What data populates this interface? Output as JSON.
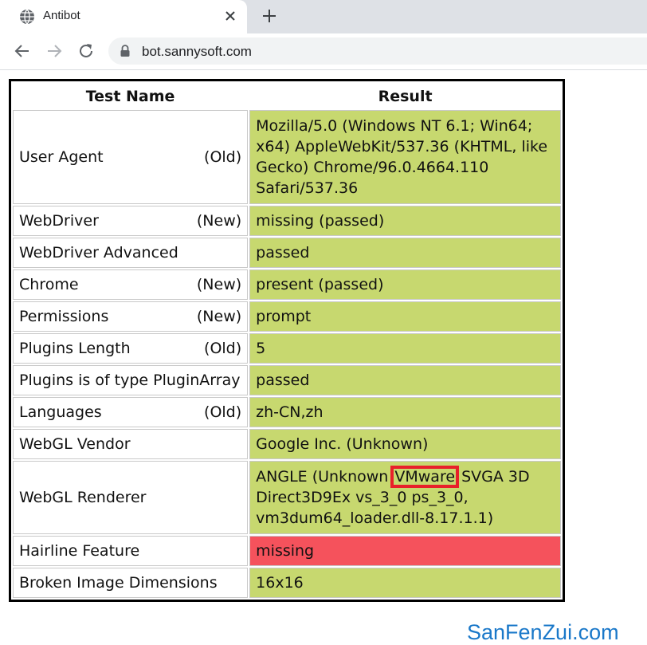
{
  "browser": {
    "tab_title": "Antibot",
    "url": "bot.sannysoft.com"
  },
  "table": {
    "headers": [
      "Test Name",
      "Result"
    ],
    "rows": [
      {
        "name": "User Agent",
        "tag": "(Old)",
        "result": "Mozilla/5.0 (Windows NT 6.1; Win64; x64) AppleWebKit/537.36 (KHTML, like Gecko) Chrome/96.0.4664.110 Safari/537.36",
        "status": "passed"
      },
      {
        "name": "WebDriver",
        "tag": "(New)",
        "result": "missing (passed)",
        "status": "passed"
      },
      {
        "name": "WebDriver Advanced",
        "tag": "",
        "result": "passed",
        "status": "passed"
      },
      {
        "name": "Chrome",
        "tag": "(New)",
        "result": "present (passed)",
        "status": "passed"
      },
      {
        "name": "Permissions",
        "tag": "(New)",
        "result": "prompt",
        "status": "passed"
      },
      {
        "name": "Plugins Length",
        "tag": "(Old)",
        "result": "5",
        "status": "passed"
      },
      {
        "name": "Plugins is of type PluginArray",
        "tag": "",
        "result": "passed",
        "status": "passed"
      },
      {
        "name": "Languages",
        "tag": "(Old)",
        "result": "zh-CN,zh",
        "status": "passed"
      },
      {
        "name": "WebGL Vendor",
        "tag": "",
        "result": "Google Inc. (Unknown)",
        "status": "passed"
      },
      {
        "name": "WebGL Renderer",
        "tag": "",
        "result_before": "ANGLE (Unknown ",
        "result_highlight": "VMware",
        "result_after": " SVGA 3D Direct3D9Ex vs_3_0 ps_3_0, vm3dum64_loader.dll-8.17.1.1)",
        "status": "passed"
      },
      {
        "name": "Hairline Feature",
        "tag": "",
        "result": "missing",
        "status": "failed"
      },
      {
        "name": "Broken Image Dimensions",
        "tag": "",
        "result": "16x16",
        "status": "passed"
      }
    ]
  },
  "colors": {
    "passed": "#c7d86f",
    "failed": "#f5525c",
    "highlight_box": "#e8202a"
  },
  "watermark": "SanFenZui.com",
  "icons": [
    "globe-icon",
    "close-icon",
    "plus-icon",
    "back-arrow-icon",
    "forward-arrow-icon",
    "reload-icon",
    "lock-icon"
  ]
}
